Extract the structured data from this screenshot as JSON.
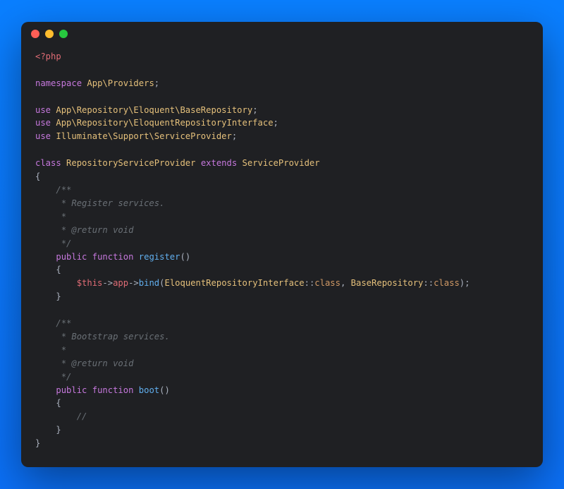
{
  "code": {
    "open_tag": "<?php",
    "kw_namespace": "namespace",
    "ns_app_providers": "App\\Providers",
    "kw_use": "use",
    "use1": "App\\Repository\\Eloquent\\BaseRepository",
    "use2": "App\\Repository\\EloquentRepositoryInterface",
    "use3": "Illuminate\\Support\\ServiceProvider",
    "kw_class": "class",
    "class_name": "RepositoryServiceProvider",
    "kw_extends": "extends",
    "parent_class": "ServiceProvider",
    "doc_open": "/**",
    "doc_reg_line": " * Register services.",
    "doc_bootstrap_line": " * Bootstrap services.",
    "doc_blank": " *",
    "doc_return": " * @return void",
    "doc_close": " */",
    "kw_public": "public",
    "kw_function": "function",
    "fn_register": "register",
    "fn_boot": "boot",
    "var_this": "$this",
    "prop_app": "app",
    "fn_bind": "bind",
    "type_eri": "EloquentRepositoryInterface",
    "type_base": "BaseRepository",
    "const_class": "class",
    "slashslash": "//",
    "brace_open": "{",
    "brace_close": "}",
    "paren_open": "(",
    "paren_close": ")",
    "semi": ";",
    "arrow": "->",
    "dblcolon": "::",
    "comma": ", "
  }
}
